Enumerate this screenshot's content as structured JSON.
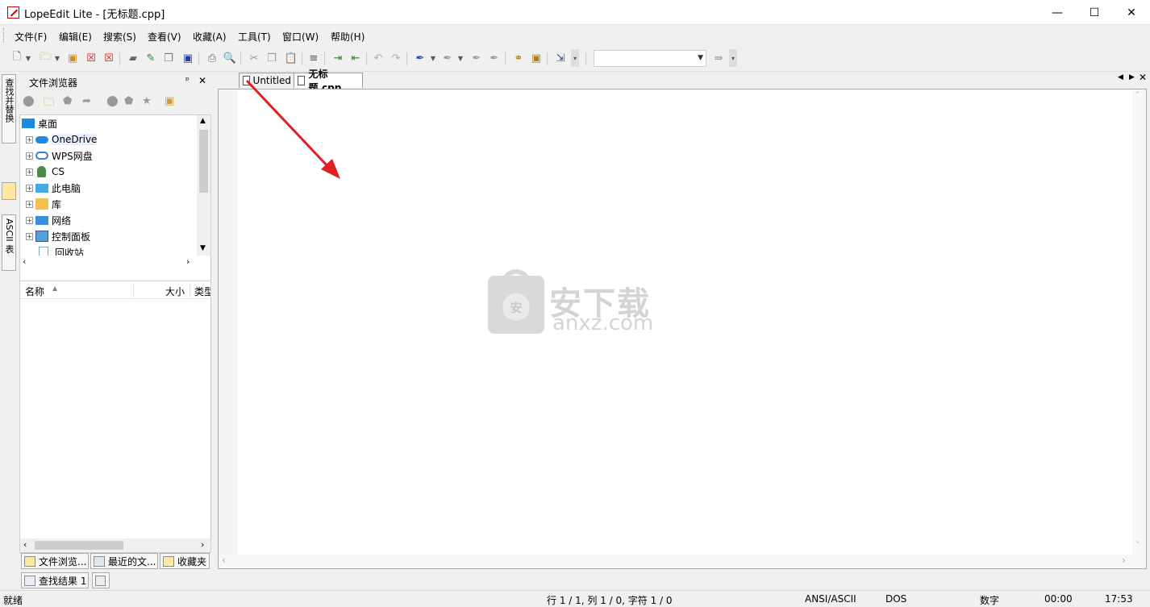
{
  "window": {
    "title": "LopeEdit Lite - [无标题.cpp]",
    "minimize": "—",
    "maximize": "☐",
    "close": "✕"
  },
  "menu": {
    "file": "文件(F)",
    "edit": "编辑(E)",
    "search": "搜索(S)",
    "view": "查看(V)",
    "favorites": "收藏(A)",
    "tools": "工具(T)",
    "window": "窗口(W)",
    "help": "帮助(H)"
  },
  "side_tabs": {
    "find_replace": "查找并替换",
    "ascii_table": "ASCII 表"
  },
  "file_browser": {
    "title": "文件浏览器",
    "pin": "ᵖ",
    "close": "✕",
    "tree": [
      {
        "label": "桌面",
        "icon": "desktop-icon",
        "expand": ""
      },
      {
        "label": "OneDrive",
        "icon": "onedrive-icon",
        "expand": "+"
      },
      {
        "label": "WPS网盘",
        "icon": "cloud-icon",
        "expand": "+"
      },
      {
        "label": "CS",
        "icon": "user-icon",
        "expand": "+"
      },
      {
        "label": "此电脑",
        "icon": "computer-icon",
        "expand": "+"
      },
      {
        "label": "库",
        "icon": "library-icon",
        "expand": "+"
      },
      {
        "label": "网络",
        "icon": "network-icon",
        "expand": "+"
      },
      {
        "label": "控制面板",
        "icon": "control-panel-icon",
        "expand": "+"
      },
      {
        "label": "回收站",
        "icon": "recycle-bin-icon",
        "expand": ""
      }
    ],
    "columns": {
      "name": "名称",
      "size": "大小",
      "type": "类型"
    },
    "bottom_tabs": [
      "文件浏览...",
      "最近的文...",
      "收藏夹"
    ]
  },
  "editor": {
    "tabs": [
      {
        "label": "Untitled",
        "active": false
      },
      {
        "label": "无标题.cpp",
        "active": true
      }
    ],
    "watermark_cn": "安下载",
    "watermark_en": "anxz.com",
    "watermark_badge": "安"
  },
  "find_results": {
    "tab": "查找结果 1"
  },
  "status": {
    "ready": "就绪",
    "position": "行 1 / 1, 列 1 / 0, 字符 1 / 0",
    "encoding": "ANSI/ASCII",
    "line_ending": "DOS",
    "numlock": "数字",
    "time_elapsed": "00:00",
    "clock": "17:53"
  },
  "colors": {
    "arrow": "#e02020",
    "watermark": "#d4d4d4",
    "chrome": "#f0f0f0"
  }
}
